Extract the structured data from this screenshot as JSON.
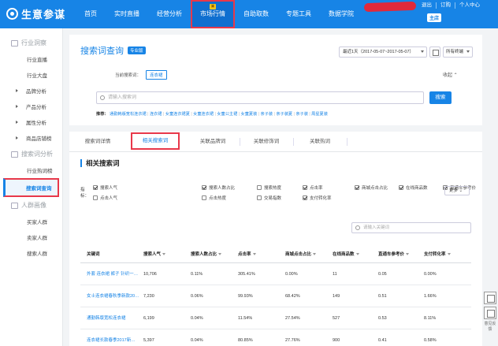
{
  "brand": {
    "name": "生意参谋"
  },
  "nav": {
    "items": [
      {
        "label": "首页",
        "active": false
      },
      {
        "label": "实时直播",
        "active": false
      },
      {
        "label": "经营分析",
        "active": false
      },
      {
        "label": "市场行情",
        "active": true
      },
      {
        "label": "自助取数",
        "active": false
      },
      {
        "label": "专题工具",
        "active": false
      },
      {
        "label": "数据学院",
        "active": false
      }
    ],
    "top_links": [
      "退出",
      "订购",
      "个人中心"
    ],
    "shop_badge": "主店"
  },
  "sidebar": {
    "groups": [
      {
        "label": "行业洞察",
        "items": [
          {
            "label": "行业直播",
            "type": "item"
          },
          {
            "label": "行业大盘",
            "type": "item"
          },
          {
            "label": "品牌分析",
            "type": "expand"
          },
          {
            "label": "产品分析",
            "type": "expand"
          },
          {
            "label": "属性分析",
            "type": "expand"
          },
          {
            "label": "商品店铺榜",
            "type": "expand"
          }
        ]
      },
      {
        "label": "搜索词分析",
        "items": [
          {
            "label": "行业热词榜",
            "type": "item"
          },
          {
            "label": "搜索词查询",
            "type": "item",
            "active": true
          }
        ]
      },
      {
        "label": "人群画像",
        "items": [
          {
            "label": "买家人群",
            "type": "item"
          },
          {
            "label": "卖家人群",
            "type": "item"
          },
          {
            "label": "搜索人群",
            "type": "item"
          }
        ]
      }
    ]
  },
  "header": {
    "title": "搜索词查询",
    "tag": "专业版",
    "date_range": "最近1天（2017-05-07~2017-05-07）",
    "terminal": "所有终端"
  },
  "query": {
    "current_label": "当前搜索词：",
    "current_term": "连衣裙",
    "collapse": "收起",
    "search_placeholder": "请输入搜索词",
    "search_button": "搜索",
    "recommend_label": "推荐：",
    "recommend_terms": [
      "通勤韩版宽松连衣裙",
      "连衣裙",
      "女童连衣裙夏",
      "女童连衣裙",
      "女童公主裙",
      "女童夏装",
      "亲子装",
      "亲子装夏",
      "亲子装",
      "周星夏装"
    ]
  },
  "tabs": [
    "搜索词详情",
    "相关搜索词",
    "关联品牌词",
    "关联修饰词",
    "关联热词"
  ],
  "active_tab": 1,
  "section": {
    "title": "相关搜索词"
  },
  "metrics": {
    "label": "指标：",
    "items": [
      {
        "label": "搜索人气",
        "checked": true
      },
      {
        "label": "搜索人数占比",
        "checked": true
      },
      {
        "label": "搜索热度",
        "checked": false
      },
      {
        "label": "点击率",
        "checked": true
      },
      {
        "label": "商城点击占比",
        "checked": true
      },
      {
        "label": "在线商品数",
        "checked": true
      },
      {
        "label": "直通车参考价",
        "checked": true
      },
      {
        "label": "点击人气",
        "checked": false
      },
      {
        "label": "点击热度",
        "checked": false
      },
      {
        "label": "交易指数",
        "checked": false
      },
      {
        "label": "支付转化率",
        "checked": true
      }
    ],
    "more": "更多"
  },
  "table": {
    "search_placeholder": "请输入关键词",
    "columns": [
      "关键词",
      "搜索人气",
      "搜索人数占比",
      "点击率",
      "商城点击占比",
      "在线商品数",
      "直通车参考价",
      "支付转化率"
    ],
    "rows": [
      [
        "外套 连衣裙 裤子 针织一…",
        "10,706",
        "0.11%",
        "305.41%",
        "0.00%",
        "11",
        "0.05",
        "0.00%"
      ],
      [
        "女士连衣裙春秋季新款20…",
        "7,230",
        "0.06%",
        "99.93%",
        "68.42%",
        "149",
        "0.51",
        "1.66%"
      ],
      [
        "通勤韩版宽松连衣裙",
        "6,199",
        "0.04%",
        "11.54%",
        "27.54%",
        "527",
        "0.53",
        "8.11%"
      ],
      [
        "连衣裙长款春季2017新…",
        "5,397",
        "0.04%",
        "80.85%",
        "27.76%",
        "900",
        "0.41",
        "0.58%"
      ]
    ]
  },
  "float_tools": {
    "feedback": "意见反馈"
  }
}
